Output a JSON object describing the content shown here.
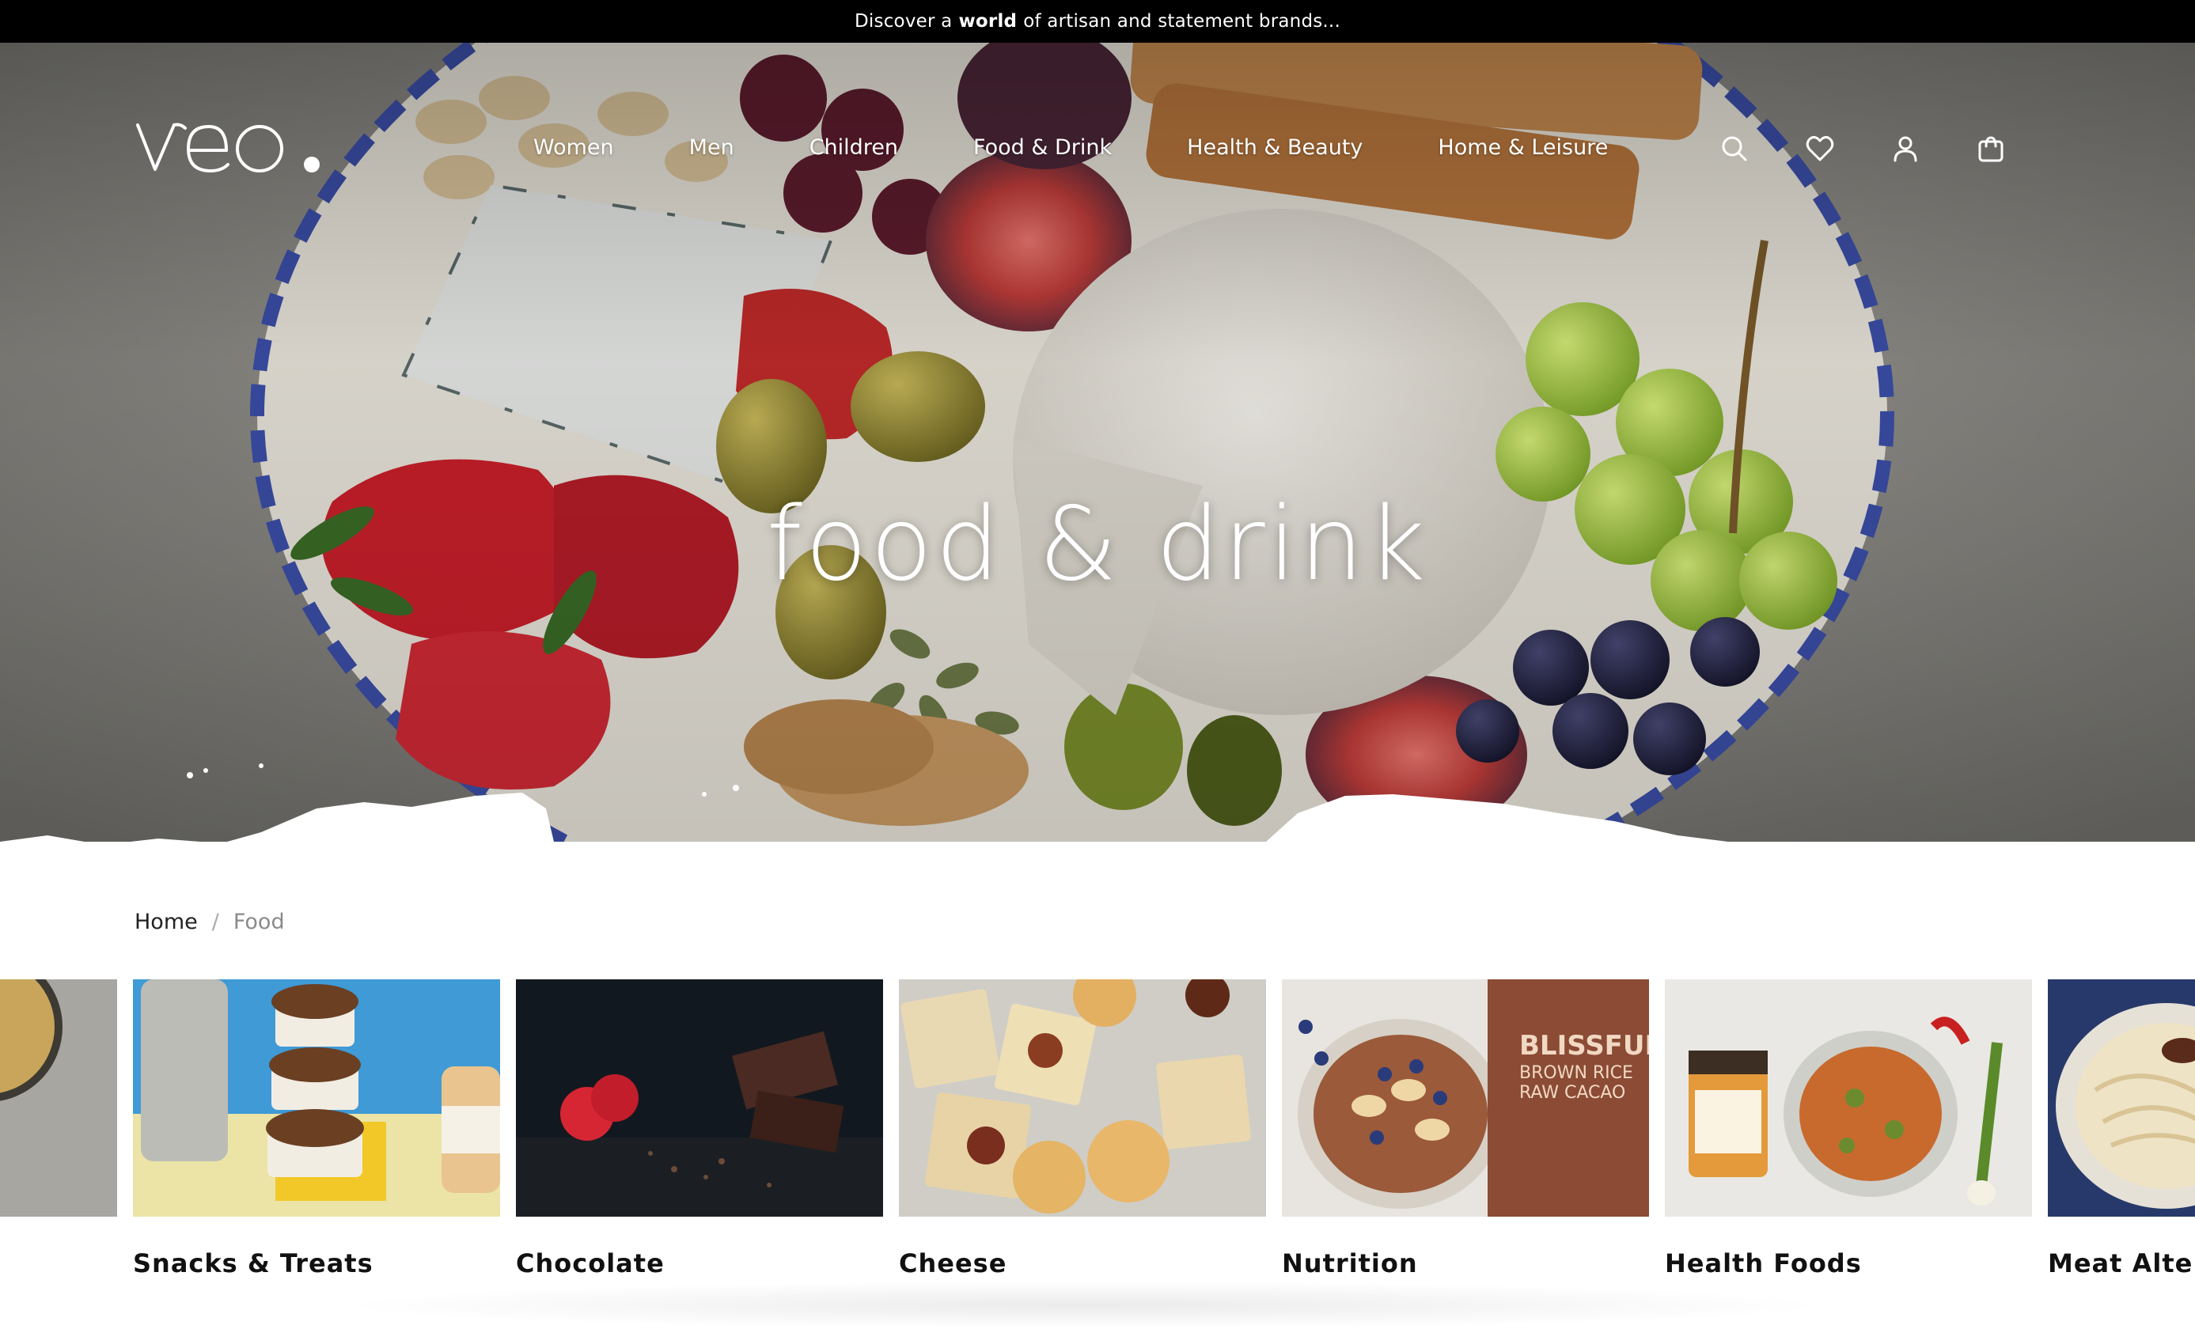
{
  "announcement": {
    "prefix": "Discover a",
    "bold": "world",
    "suffix": "of artisan and statement brands..."
  },
  "brand": {
    "logo_text": "veo."
  },
  "nav": {
    "items": [
      "Women",
      "Men",
      "Children",
      "Food & Drink",
      "Health & Beauty",
      "Home & Leisure"
    ],
    "icons": [
      "search-icon",
      "heart-icon",
      "account-icon",
      "shopping-bag-icon"
    ]
  },
  "hero": {
    "title": "food & drink"
  },
  "breadcrumb": {
    "home": "Home",
    "separator": "/",
    "current": "Food"
  },
  "categories": [
    {
      "label": ""
    },
    {
      "label": "Snacks & Treats"
    },
    {
      "label": "Chocolate"
    },
    {
      "label": "Cheese"
    },
    {
      "label": "Nutrition"
    },
    {
      "label": "Health Foods"
    },
    {
      "label": "Meat Altern"
    }
  ],
  "colors": {
    "announcement_bg": "#000000",
    "text": "#111111",
    "breadcrumb_current": "#8a8a8a"
  }
}
